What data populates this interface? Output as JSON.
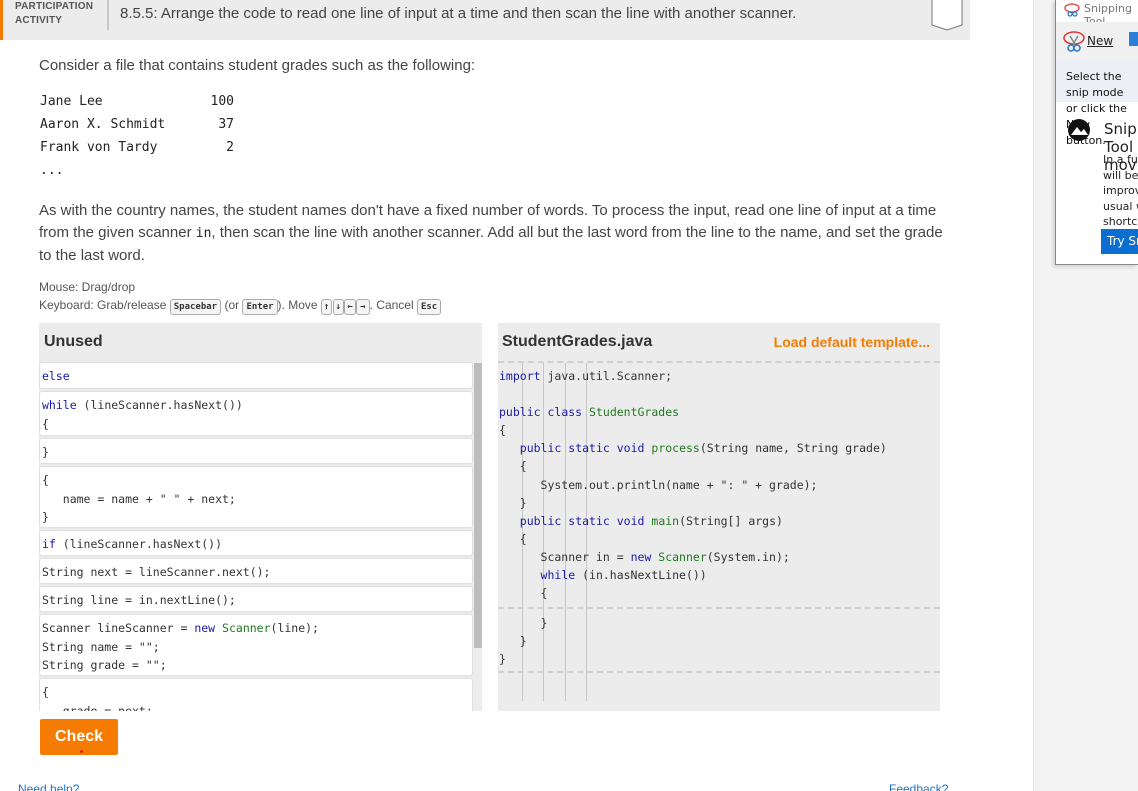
{
  "activity": {
    "label_line1": "PARTICIPATION",
    "label_line2": "ACTIVITY",
    "title": "8.5.5: Arrange the code to read one line of input at a time and then scan the line with another scanner."
  },
  "intro": "Consider a file that contains student grades such as the following:",
  "sample_data": [
    {
      "name": "Jane Lee",
      "grade": "100"
    },
    {
      "name": "Aaron X. Schmidt",
      "grade": "37"
    },
    {
      "name": "Frank von Tardy",
      "grade": "2"
    }
  ],
  "sample_ellipsis": "...",
  "description": {
    "part1": "As with the country names, the student names don't have a fixed number of words. To process the input, read one line of input at a time from the given scanner ",
    "code": "in",
    "part2": ", then scan the line with another scanner. Add all but the last word from the line to the name, and set the grade to the last word."
  },
  "help": {
    "mouse": "Mouse: Drag/drop",
    "keyboard_prefix": "Keyboard: Grab/release ",
    "key_spacebar": "Spacebar",
    "or_text": " (or ",
    "key_enter": "Enter",
    "move_text": "). Move ",
    "key_up": "↑",
    "key_down": "↓",
    "key_left": "←",
    "key_right": "→",
    "cancel_text": ". Cancel ",
    "key_esc": "Esc"
  },
  "unused": {
    "title": "Unused",
    "blocks": [
      "else",
      "while (lineScanner.hasNext())\n{",
      "}",
      "{\n   name = name + \" \" + next;\n}",
      "if (lineScanner.hasNext())",
      "String next = lineScanner.next();",
      "String line = in.nextLine();",
      "Scanner lineScanner = new Scanner(line);\nString name = \"\";\nString grade = \"\";",
      "{\n   grade = next;"
    ]
  },
  "editor": {
    "filename": "StudentGrades.java",
    "load_template": "Load default template...",
    "lines": [
      "import java.util.Scanner;",
      "public class StudentGrades",
      "{",
      "   public static void process(String name, String grade)",
      "   {",
      "      System.out.println(name + \": \" + grade);",
      "   }",
      "   public static void main(String[] args)",
      "   {",
      "      Scanner in = new Scanner(System.in);",
      "      while (in.hasNextLine())",
      "      {",
      "      }",
      "   }",
      "}"
    ]
  },
  "check_label": "Check",
  "need_help": "Need help?",
  "feedback": "Feedback?",
  "snipping": {
    "title": "Snipping Tool",
    "new_label": "New",
    "hint": "Select the snip mode or click the New button.",
    "promo_title": "Snipping Tool is moving...",
    "promo_body": "In a future update, Snipping Tool will be moving to a new home. Try improved features and snip like usual with Snip & Sketch (or try the shortcut Windows logo key + Shift + S).",
    "try_label": "Try Snip & Sketch"
  }
}
